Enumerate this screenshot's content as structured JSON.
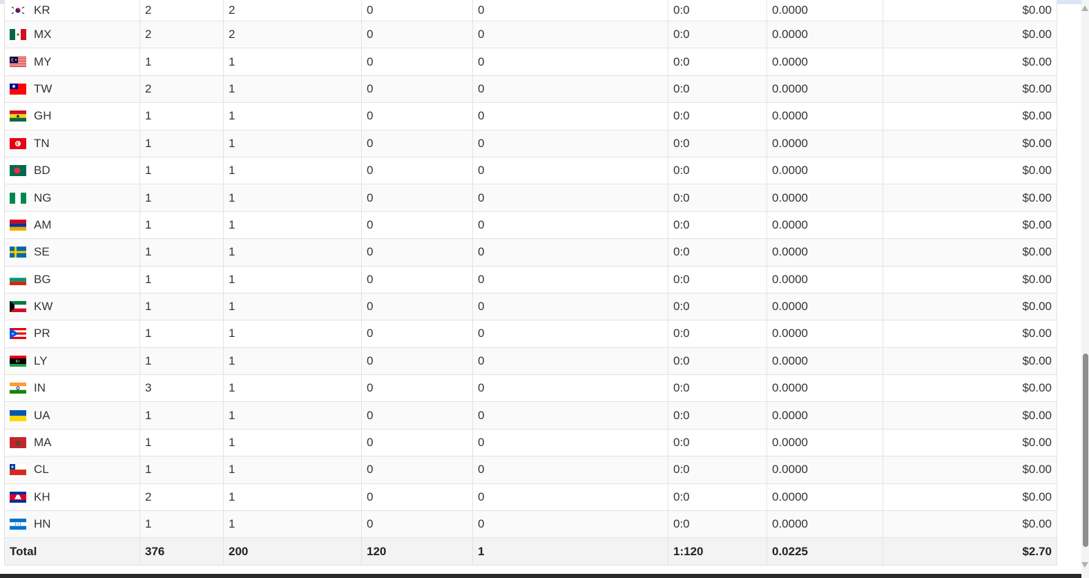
{
  "table": {
    "rows": [
      {
        "code": "KR",
        "c1": "2",
        "c2": "2",
        "c3": "0",
        "c4": "0",
        "ratio": "0:0",
        "rate": "0.0000",
        "amount": "$0.00",
        "flag": "kr-flag-icon"
      },
      {
        "code": "MX",
        "c1": "2",
        "c2": "2",
        "c3": "0",
        "c4": "0",
        "ratio": "0:0",
        "rate": "0.0000",
        "amount": "$0.00",
        "flag": "mx-flag-icon"
      },
      {
        "code": "MY",
        "c1": "1",
        "c2": "1",
        "c3": "0",
        "c4": "0",
        "ratio": "0:0",
        "rate": "0.0000",
        "amount": "$0.00",
        "flag": "my-flag-icon"
      },
      {
        "code": "TW",
        "c1": "2",
        "c2": "1",
        "c3": "0",
        "c4": "0",
        "ratio": "0:0",
        "rate": "0.0000",
        "amount": "$0.00",
        "flag": "tw-flag-icon"
      },
      {
        "code": "GH",
        "c1": "1",
        "c2": "1",
        "c3": "0",
        "c4": "0",
        "ratio": "0:0",
        "rate": "0.0000",
        "amount": "$0.00",
        "flag": "gh-flag-icon"
      },
      {
        "code": "TN",
        "c1": "1",
        "c2": "1",
        "c3": "0",
        "c4": "0",
        "ratio": "0:0",
        "rate": "0.0000",
        "amount": "$0.00",
        "flag": "tn-flag-icon"
      },
      {
        "code": "BD",
        "c1": "1",
        "c2": "1",
        "c3": "0",
        "c4": "0",
        "ratio": "0:0",
        "rate": "0.0000",
        "amount": "$0.00",
        "flag": "bd-flag-icon"
      },
      {
        "code": "NG",
        "c1": "1",
        "c2": "1",
        "c3": "0",
        "c4": "0",
        "ratio": "0:0",
        "rate": "0.0000",
        "amount": "$0.00",
        "flag": "ng-flag-icon"
      },
      {
        "code": "AM",
        "c1": "1",
        "c2": "1",
        "c3": "0",
        "c4": "0",
        "ratio": "0:0",
        "rate": "0.0000",
        "amount": "$0.00",
        "flag": "am-flag-icon"
      },
      {
        "code": "SE",
        "c1": "1",
        "c2": "1",
        "c3": "0",
        "c4": "0",
        "ratio": "0:0",
        "rate": "0.0000",
        "amount": "$0.00",
        "flag": "se-flag-icon"
      },
      {
        "code": "BG",
        "c1": "1",
        "c2": "1",
        "c3": "0",
        "c4": "0",
        "ratio": "0:0",
        "rate": "0.0000",
        "amount": "$0.00",
        "flag": "bg-flag-icon"
      },
      {
        "code": "KW",
        "c1": "1",
        "c2": "1",
        "c3": "0",
        "c4": "0",
        "ratio": "0:0",
        "rate": "0.0000",
        "amount": "$0.00",
        "flag": "kw-flag-icon"
      },
      {
        "code": "PR",
        "c1": "1",
        "c2": "1",
        "c3": "0",
        "c4": "0",
        "ratio": "0:0",
        "rate": "0.0000",
        "amount": "$0.00",
        "flag": "pr-flag-icon"
      },
      {
        "code": "LY",
        "c1": "1",
        "c2": "1",
        "c3": "0",
        "c4": "0",
        "ratio": "0:0",
        "rate": "0.0000",
        "amount": "$0.00",
        "flag": "ly-flag-icon"
      },
      {
        "code": "IN",
        "c1": "3",
        "c2": "1",
        "c3": "0",
        "c4": "0",
        "ratio": "0:0",
        "rate": "0.0000",
        "amount": "$0.00",
        "flag": "in-flag-icon"
      },
      {
        "code": "UA",
        "c1": "1",
        "c2": "1",
        "c3": "0",
        "c4": "0",
        "ratio": "0:0",
        "rate": "0.0000",
        "amount": "$0.00",
        "flag": "ua-flag-icon"
      },
      {
        "code": "MA",
        "c1": "1",
        "c2": "1",
        "c3": "0",
        "c4": "0",
        "ratio": "0:0",
        "rate": "0.0000",
        "amount": "$0.00",
        "flag": "ma-flag-icon"
      },
      {
        "code": "CL",
        "c1": "1",
        "c2": "1",
        "c3": "0",
        "c4": "0",
        "ratio": "0:0",
        "rate": "0.0000",
        "amount": "$0.00",
        "flag": "cl-flag-icon"
      },
      {
        "code": "KH",
        "c1": "2",
        "c2": "1",
        "c3": "0",
        "c4": "0",
        "ratio": "0:0",
        "rate": "0.0000",
        "amount": "$0.00",
        "flag": "kh-flag-icon"
      },
      {
        "code": "HN",
        "c1": "1",
        "c2": "1",
        "c3": "0",
        "c4": "0",
        "ratio": "0:0",
        "rate": "0.0000",
        "amount": "$0.00",
        "flag": "hn-flag-icon"
      }
    ],
    "total": {
      "label": "Total",
      "c1": "376",
      "c2": "200",
      "c3": "120",
      "c4": "1",
      "ratio": "1:120",
      "rate": "0.0225",
      "amount": "$2.70"
    }
  },
  "colors": {
    "border": "#e2e2e2",
    "row_alt": "#fafafa",
    "total_bg": "#f3f3f3",
    "text": "#333333"
  }
}
